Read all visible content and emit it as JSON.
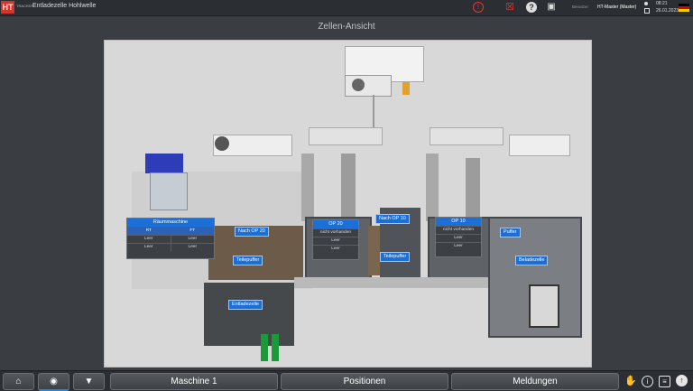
{
  "header": {
    "logo_text": "HT",
    "logo_sub": "TRACKER",
    "title": "Entladezelle Hohlwelle",
    "user_label": "Benutzer",
    "user_name": "HT-Master (Master)",
    "time": "08:21",
    "date": "26.01.2023",
    "icons": [
      "alarm-icon",
      "no-document-icon",
      "help-icon",
      "camera-icon",
      "clock-icon",
      "calendar-icon",
      "germany-flag-icon"
    ]
  },
  "view": {
    "title": "Zellen-Ansicht"
  },
  "cells": {
    "raeummaschine": {
      "title": "Räummaschine",
      "col1": "RT",
      "col2": "FT",
      "r1c1": "Leer",
      "r1c2": "Leer",
      "r2c1": "Leer",
      "r2c2": "Leer"
    },
    "op20": {
      "title": "OP 20",
      "status": "nicht vorhanden",
      "r1": "Leer",
      "r2": "Leer"
    },
    "op10": {
      "title": "OP 10",
      "status": "nicht vorhanden",
      "r1": "Leer",
      "r2": "Leer"
    },
    "labels": {
      "nach_op20": "Nach OP 20",
      "nach_op10": "Nach OP 10",
      "teilepuffer_left": "Teilepuffer",
      "teilepuffer_mid": "Teilepuffer",
      "puffer": "Puffer",
      "beladezelle": "Beladezelle",
      "entladezelle": "Entladezelle"
    }
  },
  "footer": {
    "home_icon": "home-icon",
    "eye_icon": "eye-icon",
    "location_icon": "location-pin-icon",
    "tab1": "Maschine 1",
    "tab2": "Positionen",
    "tab3": "Meldungen",
    "right_icons": [
      "hand-icon",
      "info-icon",
      "notes-icon",
      "upload-icon"
    ]
  },
  "colors": {
    "accent": "#1b6fd6",
    "alarm": "#e53935",
    "background": "#3a3d42"
  }
}
